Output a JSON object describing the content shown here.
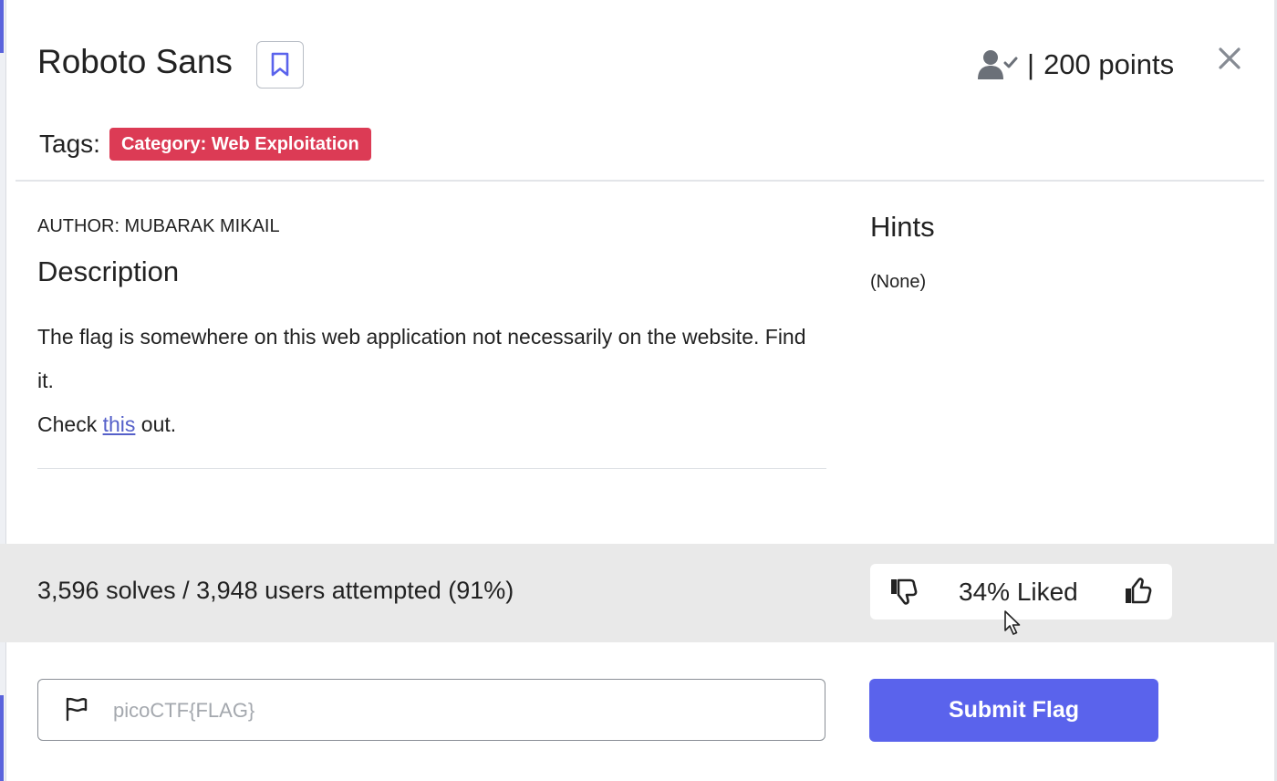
{
  "challenge": {
    "title": "Roboto Sans",
    "points_separator": "|",
    "points": "200 points"
  },
  "tags": {
    "label": "Tags:",
    "items": [
      "Category: Web Exploitation"
    ]
  },
  "body": {
    "author": "AUTHOR: MUBARAK MIKAIL",
    "description_heading": "Description",
    "description_line1": "The flag is somewhere on this web application not necessarily on the website. Find it.",
    "check_prefix": "Check ",
    "check_link": "this",
    "check_suffix": " out."
  },
  "hints": {
    "heading": "Hints",
    "value": "(None)"
  },
  "stats": {
    "solves": "3,596 solves / 3,948 users attempted (91%)",
    "liked": "34% Liked"
  },
  "flag_form": {
    "placeholder": "picoCTF{FLAG}",
    "value": "",
    "submit_label": "Submit Flag"
  },
  "colors": {
    "accent": "#5a63ec",
    "tag_bg": "#dc3b55",
    "link": "#5560c9",
    "stats_bg": "#e9e9e9"
  },
  "icons": {
    "bookmark": "bookmark-icon",
    "user_check": "user-check-icon",
    "close": "close-icon",
    "thumbs_down": "thumbs-down-icon",
    "thumbs_up": "thumbs-up-icon",
    "flag": "flag-icon",
    "cursor": "mouse-cursor-icon"
  }
}
